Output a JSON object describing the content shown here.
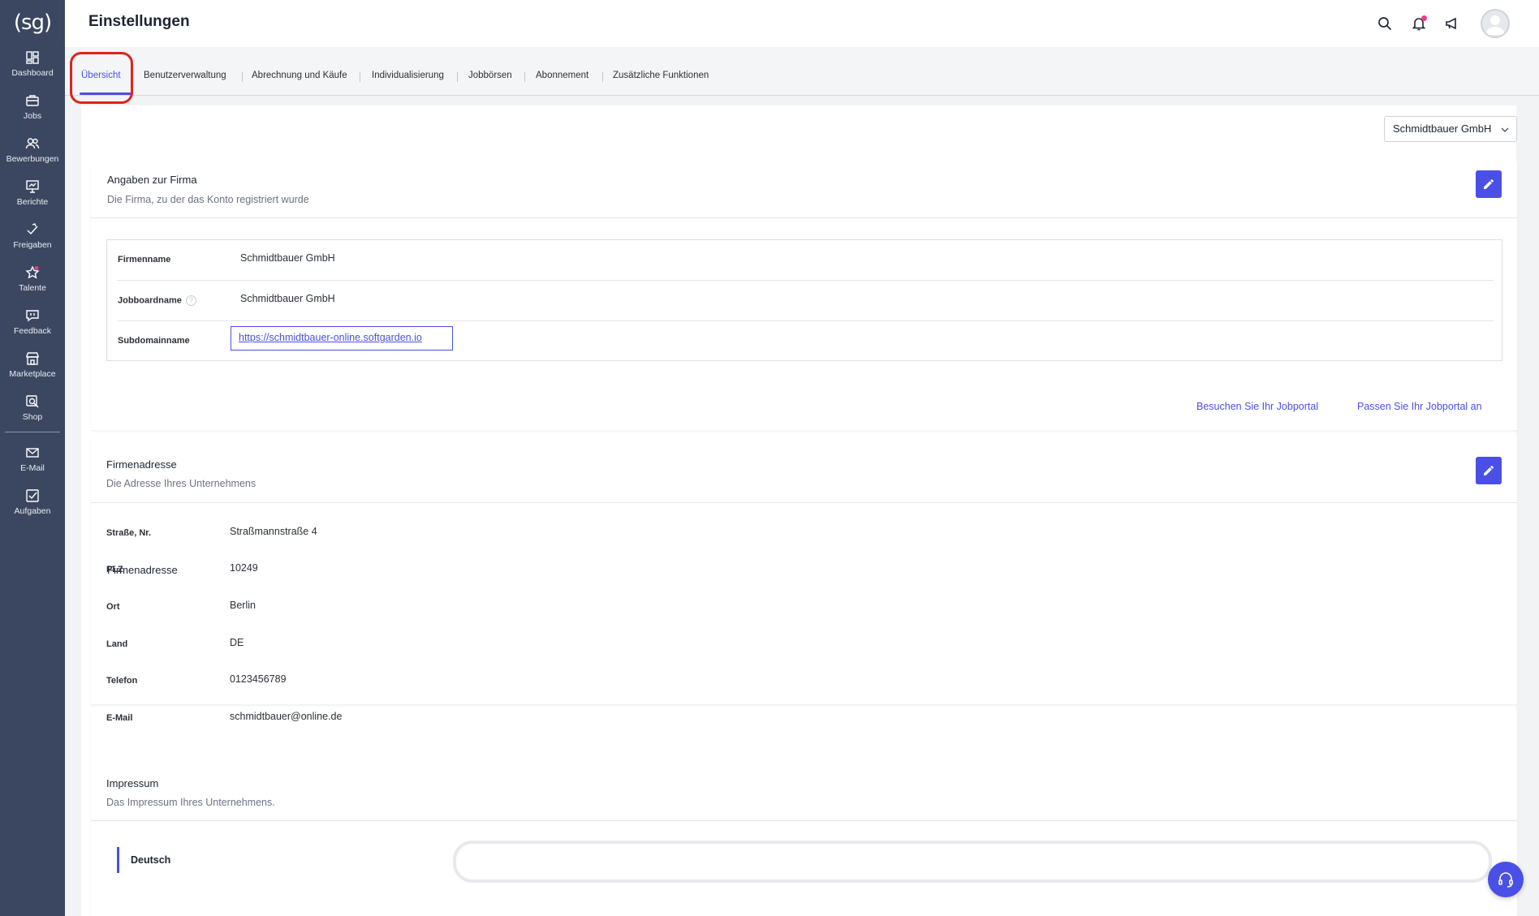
{
  "sidebar": {
    "logo": "(sg)",
    "items": [
      {
        "label": "Dashboard",
        "icon": "dashboard-icon"
      },
      {
        "label": "Jobs",
        "icon": "briefcase-icon"
      },
      {
        "label": "Bewerbungen",
        "icon": "users-icon"
      },
      {
        "label": "Berichte",
        "icon": "chart-board-icon"
      },
      {
        "label": "Freigaben",
        "icon": "approval-icon"
      },
      {
        "label": "Talente",
        "icon": "star-icon"
      },
      {
        "label": "Feedback",
        "icon": "chat-icon"
      },
      {
        "label": "Marketplace",
        "icon": "store-icon"
      },
      {
        "label": "Shop",
        "icon": "shop-search-icon"
      },
      {
        "label": "E-Mail",
        "icon": "mail-icon"
      },
      {
        "label": "Aufgaben",
        "icon": "checkbox-icon"
      }
    ]
  },
  "header": {
    "title": "Einstellungen",
    "icons": [
      "search-icon",
      "bell-icon",
      "megaphone-icon",
      "avatar",
      "chevron-down-icon"
    ]
  },
  "tabs": [
    {
      "label": "Übersicht",
      "active": true
    },
    {
      "label": "Benutzerverwaltung"
    },
    {
      "label": "Abrechnung und Käufe"
    },
    {
      "label": "Individualisierung"
    },
    {
      "label": "Jobbörsen"
    },
    {
      "label": "Abonnement"
    },
    {
      "label": "Zusätzliche Funktionen"
    }
  ],
  "company_select": {
    "value": "Schmidtbauer GmbH"
  },
  "firma": {
    "title": "Angaben zur Firma",
    "subtitle": "Die Firma, zu der das Konto registriert wurde",
    "rows": [
      {
        "key": "Firmenname",
        "value": "Schmidtbauer GmbH"
      },
      {
        "key": "Jobboardname",
        "value": "Schmidtbauer GmbH"
      },
      {
        "key": "Subdomainname",
        "value": "https://schmidtbauer-online.softgarden.io"
      }
    ],
    "links": {
      "visit": "Besuchen Sie Ihr Jobportal",
      "customize": "Passen Sie Ihr Jobportal an"
    }
  },
  "adresse": {
    "title": "Firmenadresse",
    "subtitle": "Die Adresse Ihres Unternehmens",
    "rows": [
      {
        "key": "Straße, Nr.",
        "value": "Straßmannstraße 4"
      },
      {
        "key": "PLZ",
        "value": "10249"
      },
      {
        "key": "Ort",
        "value": "Berlin"
      },
      {
        "key": "Land",
        "value": "DE"
      },
      {
        "key": "Telefon",
        "value": "0123456789"
      },
      {
        "key": "E-Mail",
        "value": "schmidtbauer@online.de"
      }
    ]
  },
  "impressum": {
    "title": "Impressum",
    "subtitle": "Das Impressum Ihres Unternehmens.",
    "language": "Deutsch"
  },
  "colors": {
    "accent": "#4a50e6",
    "sidebar": "#3b4760",
    "highlight": "#e0231c"
  }
}
